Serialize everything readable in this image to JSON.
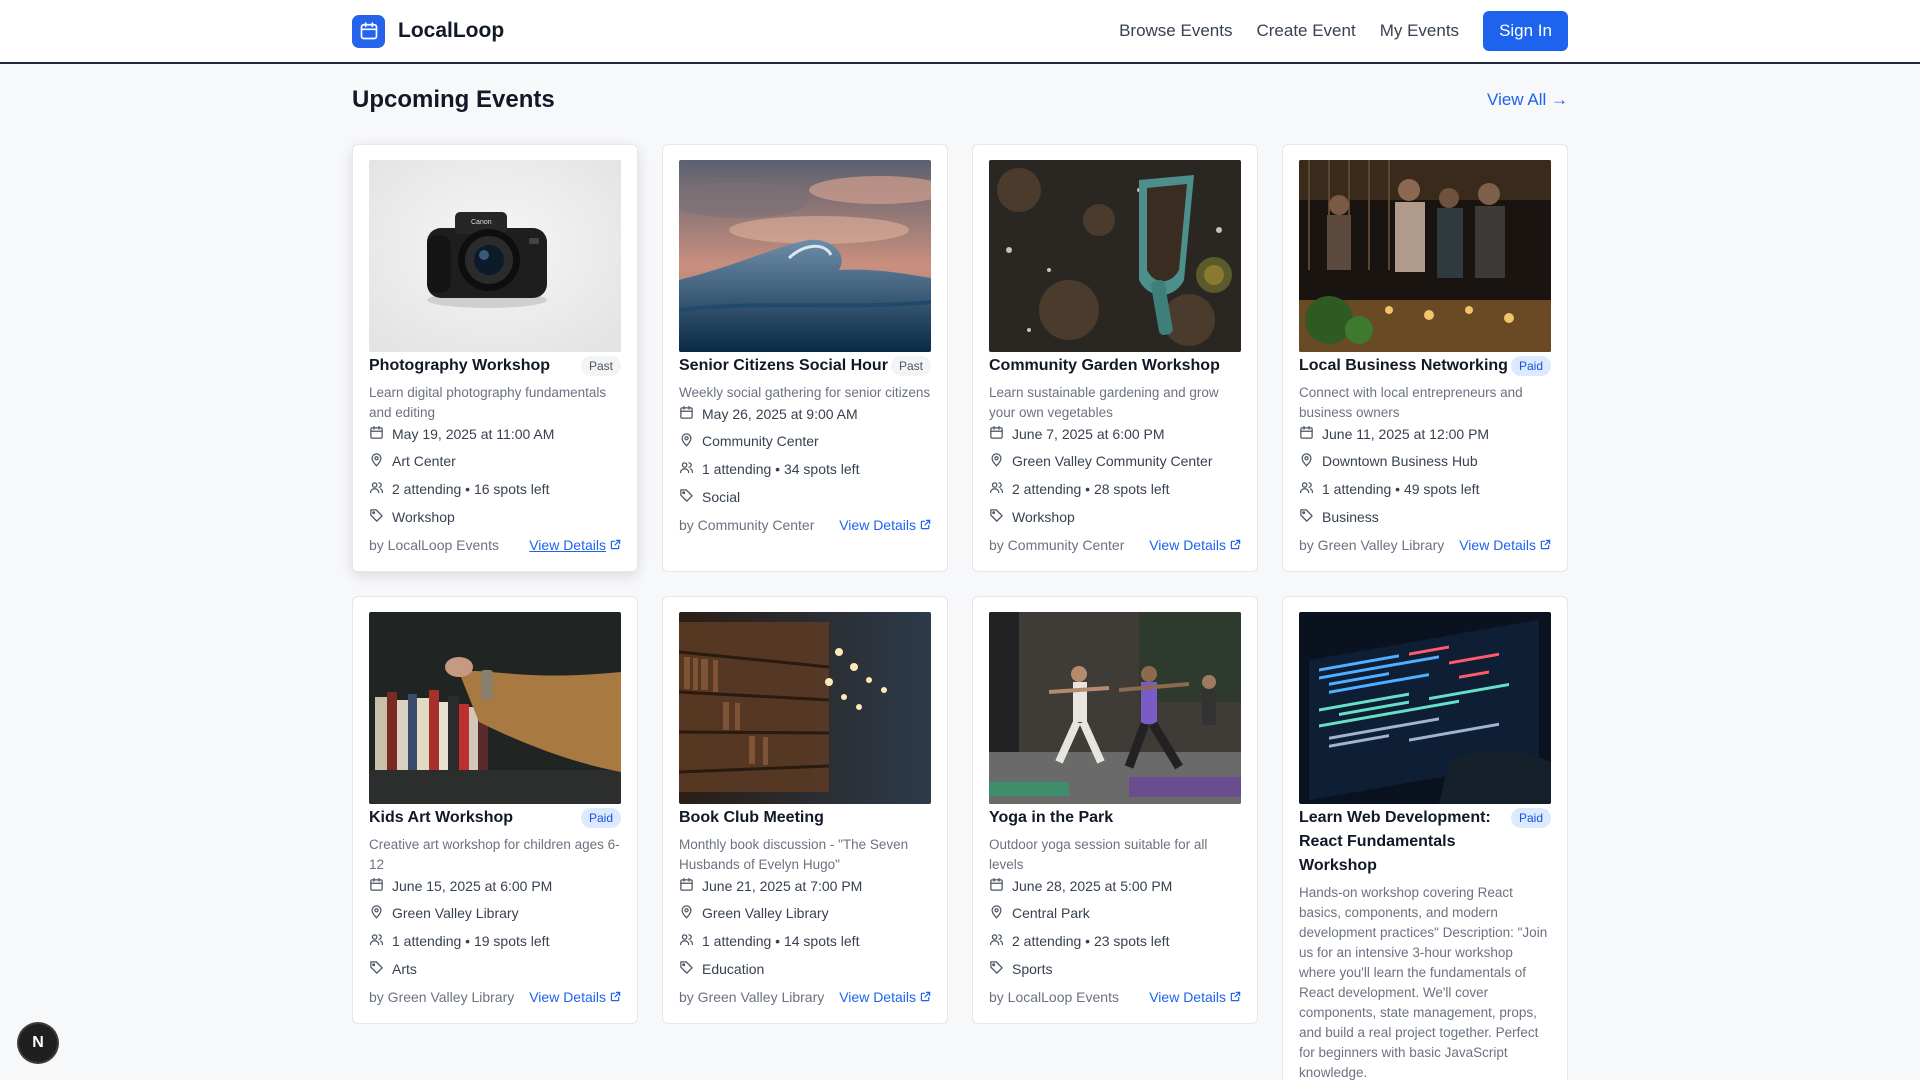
{
  "header": {
    "brand": "LocalLoop",
    "nav": [
      "Browse Events",
      "Create Event",
      "My Events"
    ],
    "signin": "Sign In"
  },
  "section": {
    "title": "Upcoming Events",
    "view_all": "View All →"
  },
  "events": [
    {
      "title": "Photography Workshop",
      "badge": "Past",
      "description": "Learn digital photography fundamentals and editing",
      "date": "May 19, 2025 at 11:00 AM",
      "location": "Art Center",
      "attendance": "2 attending • 16 spots left",
      "category": "Workshop",
      "organizer": "by LocalLoop Events",
      "details": "View Details",
      "image": "camera"
    },
    {
      "title": "Senior Citizens Social Hour",
      "badge": "Past",
      "description": "Weekly social gathering for senior citizens",
      "date": "May 26, 2025 at 9:00 AM",
      "location": "Community Center",
      "attendance": "1 attending • 34 spots left",
      "category": "Social",
      "organizer": "by Community Center",
      "details": "View Details",
      "image": "wave"
    },
    {
      "title": "Community Garden Workshop",
      "badge": "",
      "description": "Learn sustainable gardening and grow your own vegetables",
      "date": "June 7, 2025 at 6:00 PM",
      "location": "Green Valley Community Center",
      "attendance": "2 attending • 28 spots left",
      "category": "Workshop",
      "organizer": "by Community Center",
      "details": "View Details",
      "image": "garden"
    },
    {
      "title": "Local Business Networking",
      "badge": "Paid",
      "description": "Connect with local entrepreneurs and business owners",
      "date": "June 11, 2025 at 12:00 PM",
      "location": "Downtown Business Hub",
      "attendance": "1 attending • 49 spots left",
      "category": "Business",
      "organizer": "by Green Valley Library",
      "details": "View Details",
      "image": "networking"
    },
    {
      "title": "Kids Art Workshop",
      "badge": "Paid",
      "description": "Creative art workshop for children ages 6-12",
      "date": "June 15, 2025 at 6:00 PM",
      "location": "Green Valley Library",
      "attendance": "1 attending • 19 spots left",
      "category": "Arts",
      "organizer": "by Green Valley Library",
      "details": "View Details",
      "image": "books"
    },
    {
      "title": "Book Club Meeting",
      "badge": "",
      "description": "Monthly book discussion - \"The Seven Husbands of Evelyn Hugo\"",
      "date": "June 21, 2025 at 7:00 PM",
      "location": "Green Valley Library",
      "attendance": "1 attending • 14 spots left",
      "category": "Education",
      "organizer": "by Green Valley Library",
      "details": "View Details",
      "image": "library"
    },
    {
      "title": "Yoga in the Park",
      "badge": "",
      "description": "Outdoor yoga session suitable for all levels",
      "date": "June 28, 2025 at 5:00 PM",
      "location": "Central Park",
      "attendance": "2 attending • 23 spots left",
      "category": "Sports",
      "organizer": "by LocalLoop Events",
      "details": "View Details",
      "image": "yoga"
    },
    {
      "title": "Learn Web Development: React Fundamentals Workshop",
      "badge": "Paid",
      "description": "Hands-on workshop covering React basics, components, and modern development practices\" Description: \"Join us for an intensive 3-hour workshop where you'll learn the fundamentals of React development. We'll cover components, state management, props, and build a real project together. Perfect for beginners with basic JavaScript knowledge.",
      "date": "",
      "location": "",
      "attendance": "",
      "category": "",
      "organizer": "",
      "details": "",
      "image": "code"
    }
  ],
  "dev_badge": "N",
  "colors": {
    "accent": "#1d63ed",
    "paid_badge_bg": "#dbeafe",
    "past_badge_bg": "#f3f4f6"
  }
}
